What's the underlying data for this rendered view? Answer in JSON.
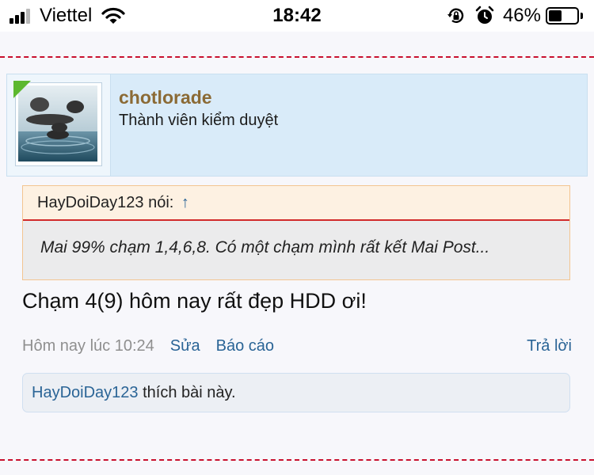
{
  "status_bar": {
    "carrier": "Viettel",
    "time": "18:42",
    "battery_percent_label": "46%",
    "battery_level": 0.46
  },
  "post": {
    "author": {
      "username": "chotlorade",
      "title": "Thành viên kiểm duyệt"
    },
    "quote": {
      "attribution": "HayDoiDay123 nói:",
      "arrow": "↑",
      "text": "Mai 99% chạm 1,4,6,8. Có một chạm mình rất kết Mai Post..."
    },
    "message": "Chạm 4(9) hôm nay rất đẹp HDD ơi!",
    "meta": {
      "date": "Hôm nay lúc 10:24",
      "edit_label": "Sửa",
      "report_label": "Báo cáo",
      "reply_label": "Trả lời"
    },
    "likes": {
      "user": "HayDoiDay123",
      "text": "thích bài này."
    }
  },
  "colors": {
    "username": "#8b6a35",
    "link": "#2a6496",
    "divider": "#c8102e",
    "usercard_bg": "#d9ebf9"
  }
}
